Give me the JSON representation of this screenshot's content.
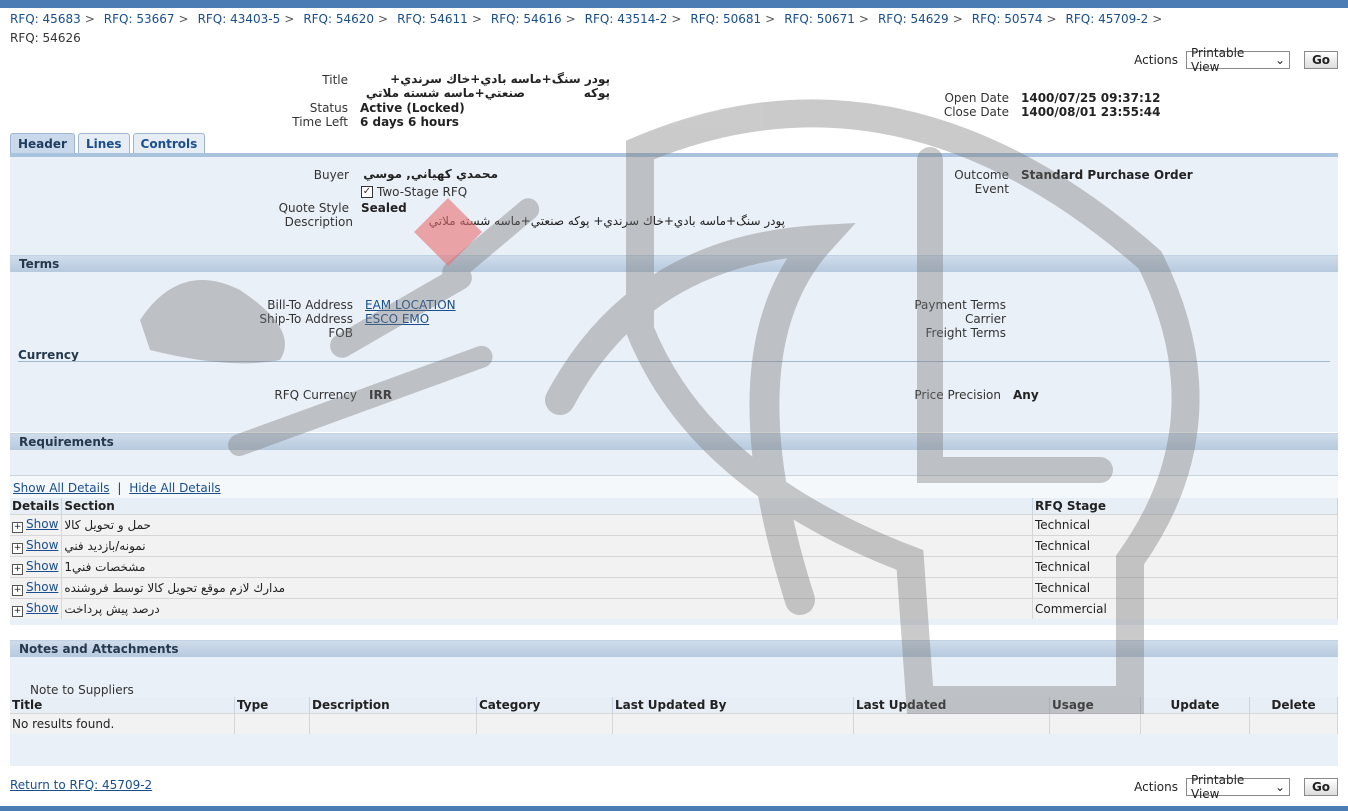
{
  "breadcrumbs": [
    "RFQ: 45683",
    "RFQ: 53667",
    "RFQ: 43403-5",
    "RFQ: 54620",
    "RFQ: 54611",
    "RFQ: 54616",
    "RFQ: 43514-2",
    "RFQ: 50681",
    "RFQ: 50671",
    "RFQ: 54629",
    "RFQ: 50574",
    "RFQ: 45709-2"
  ],
  "page_title": "RFQ: 54626",
  "actions": {
    "label": "Actions",
    "select_value": "Printable View",
    "go": "Go"
  },
  "summary": {
    "title_label": "Title",
    "title_line1": "پودر سنگ+ماسه بادي+خاك سرندي+ پوكه",
    "title_line2": "صنعتي+ماسه شسته ملاتي",
    "status_label": "Status",
    "status": "Active (Locked)",
    "time_left_label": "Time Left",
    "time_left": "6 days 6 hours",
    "open_date_label": "Open Date",
    "open_date": "1400/07/25 09:37:12",
    "close_date_label": "Close Date",
    "close_date": "1400/08/01 23:55:44"
  },
  "tabs": [
    "Header",
    "Lines",
    "Controls"
  ],
  "header": {
    "buyer_label": "Buyer",
    "buyer": "محمدي كهياني, موسي",
    "two_stage": "Two-Stage RFQ",
    "quote_style_label": "Quote Style",
    "quote_style": "Sealed",
    "description_label": "Description",
    "description": "پودر سنگ+ماسه بادي+خاك سرندي+ پوكه صنعتي+ماسه شسته ملاتي",
    "outcome_label": "Outcome",
    "outcome": "Standard Purchase Order",
    "event_label": "Event"
  },
  "terms": {
    "heading": "Terms",
    "bill_to_label": "Bill-To Address",
    "bill_to": "EAM LOCATION",
    "ship_to_label": "Ship-To Address",
    "ship_to": "ESCO EMO",
    "fob_label": "FOB",
    "payment_terms_label": "Payment Terms",
    "carrier_label": "Carrier",
    "freight_terms_label": "Freight Terms",
    "currency_heading": "Currency",
    "rfq_currency_label": "RFQ Currency",
    "rfq_currency": "IRR",
    "price_precision_label": "Price Precision",
    "price_precision": "Any"
  },
  "requirements": {
    "heading": "Requirements",
    "show_all": "Show All Details",
    "hide_all": "Hide All Details",
    "columns": [
      "Details",
      "Section",
      "RFQ Stage"
    ],
    "show_label": "Show",
    "rows": [
      {
        "section": "حمل و تحويل كالا",
        "stage": "Technical"
      },
      {
        "section": "نمونه/بازديد فني",
        "stage": "Technical"
      },
      {
        "section": "مشخصات فني1",
        "stage": "Technical"
      },
      {
        "section": "مدارك لازم موقع تحويل كالا توسط فروشنده",
        "stage": "Technical"
      },
      {
        "section": "درصد پيش پرداخت",
        "stage": "Commercial"
      }
    ]
  },
  "notes": {
    "heading": "Notes and Attachments",
    "note_to_suppliers": "Note to Suppliers",
    "columns": [
      "Title",
      "Type",
      "Description",
      "Category",
      "Last Updated By",
      "Last Updated",
      "Usage",
      "Update",
      "Delete"
    ],
    "empty": "No results found."
  },
  "footer": {
    "return_link": "Return to RFQ: 45709-2"
  }
}
